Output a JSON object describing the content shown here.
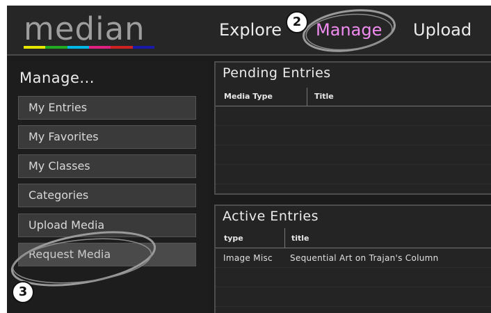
{
  "brand": {
    "logo_text": "median",
    "bar_colors": [
      "#e6e600",
      "#22aa22",
      "#00b8e6",
      "#e02080",
      "#cc2222",
      "#1a1aa8"
    ]
  },
  "nav": {
    "explore": "Explore",
    "manage": "Manage",
    "upload": "Upload",
    "manage_color": "#f08cf0"
  },
  "sidebar": {
    "heading": "Manage...",
    "items": [
      {
        "label": "My Entries"
      },
      {
        "label": "My Favorites"
      },
      {
        "label": "My Classes"
      },
      {
        "label": "Categories"
      },
      {
        "label": "Upload Media"
      },
      {
        "label": "Request Media"
      }
    ]
  },
  "pending": {
    "title": "Pending Entries",
    "columns": [
      "Media Type",
      "Title"
    ]
  },
  "active": {
    "title": "Active Entries",
    "columns": [
      "type",
      "title"
    ],
    "rows": [
      {
        "type": "Image Misc",
        "title": "Sequential Art on Trajan's Column"
      }
    ]
  },
  "annotations": {
    "step2": "2",
    "step3": "3"
  }
}
